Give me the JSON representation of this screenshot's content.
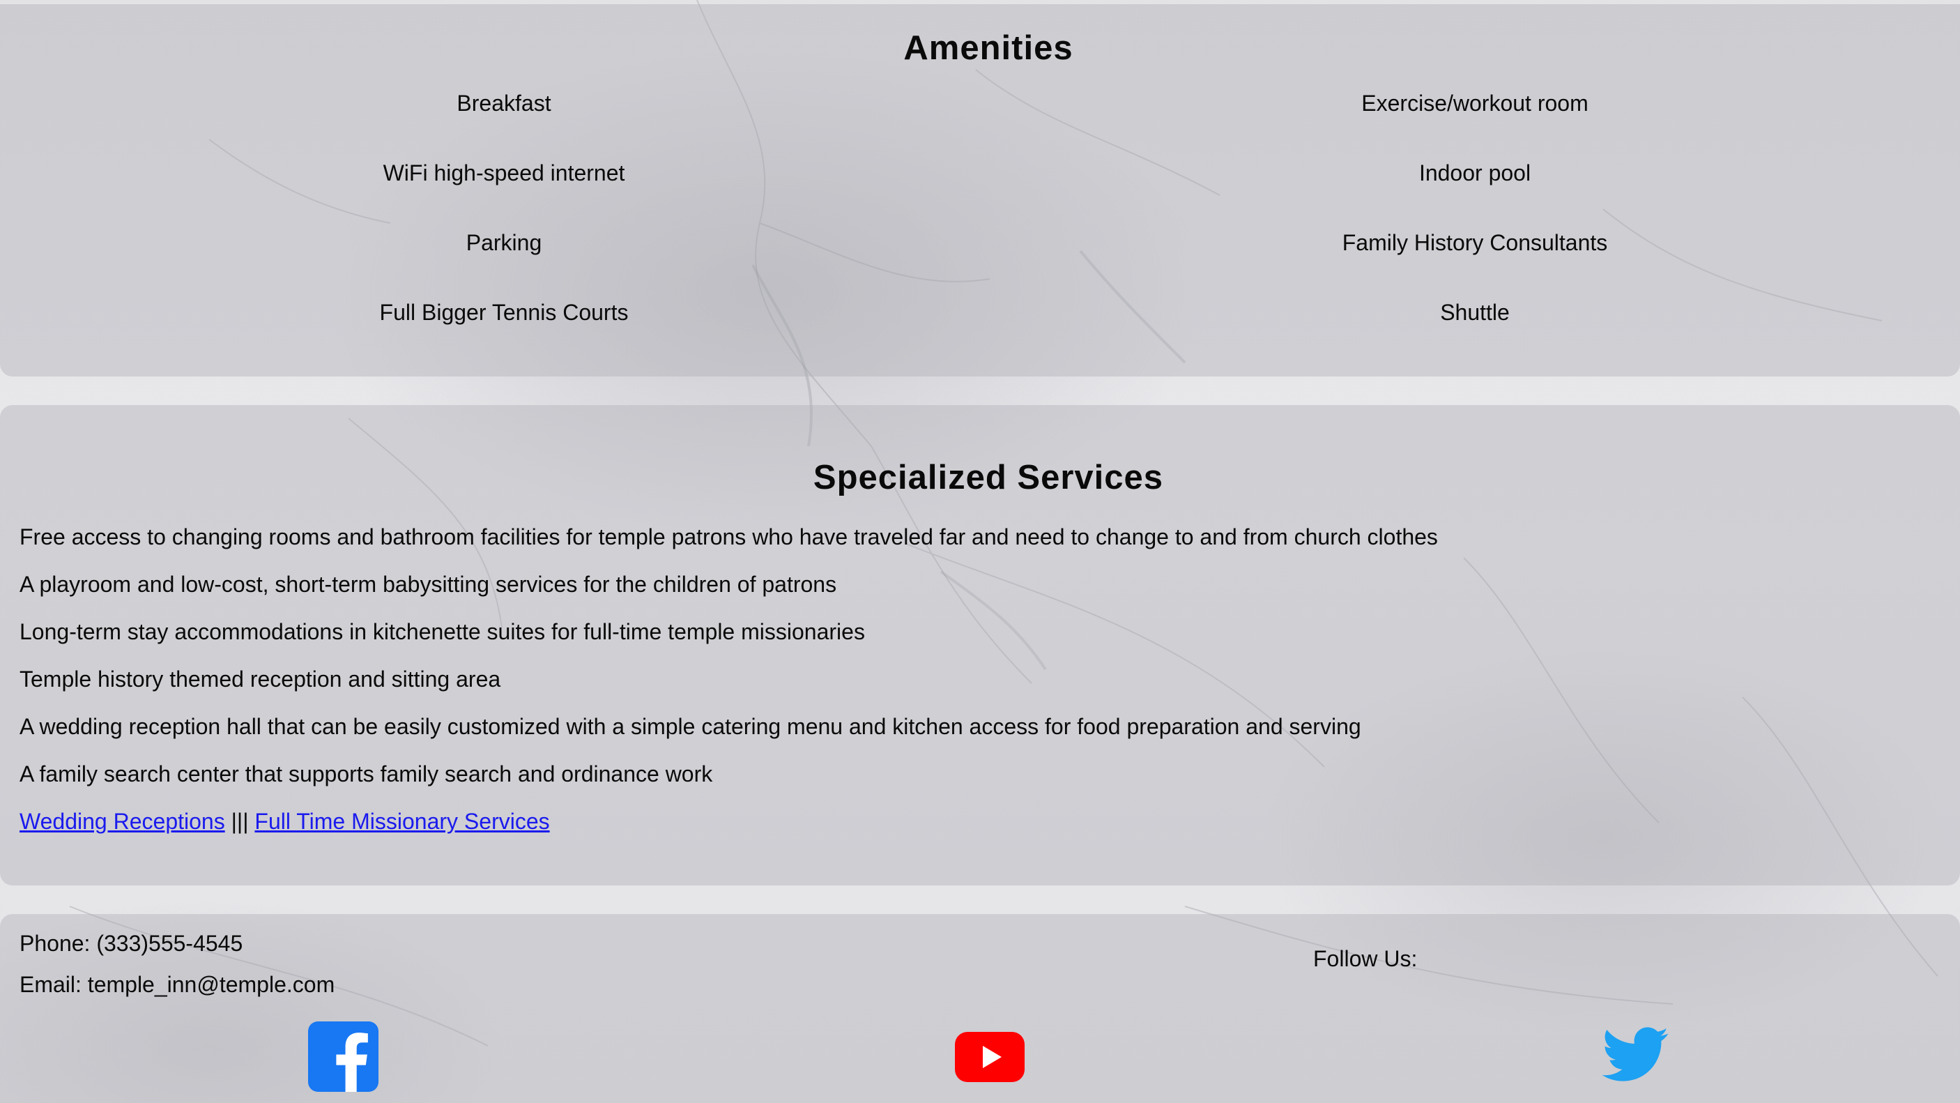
{
  "amenities": {
    "title": "Amenities",
    "left": [
      "Breakfast",
      "WiFi high-speed internet",
      "Parking",
      "Full Bigger Tennis Courts"
    ],
    "right": [
      "Exercise/workout room",
      "Indoor pool",
      "Family History Consultants",
      "Shuttle"
    ]
  },
  "services": {
    "title": "Specialized Services",
    "items": [
      "Free access to changing rooms and bathroom facilities for temple patrons who have traveled far and need to change to and from church clothes",
      "A playroom and low-cost, short-term babysitting services for the children of patrons",
      "Long-term stay accommodations in kitchenette suites for full-time temple missionaries",
      "Temple history themed reception and sitting area",
      "A wedding reception hall that can be easily customized with a simple catering menu and kitchen access for food preparation and serving",
      "A family search center that supports family search and ordinance work"
    ],
    "link_wedding": "Wedding Receptions",
    "link_separator": " ||| ",
    "link_missionary": "Full Time Missionary Services"
  },
  "footer": {
    "phone": "Phone: (333)555-4545",
    "email": "Email: temple_inn@temple.com",
    "follow": "Follow Us:",
    "social_icons": [
      "facebook-icon",
      "youtube-icon",
      "twitter-icon"
    ]
  },
  "colors": {
    "link": "#1a1aee",
    "facebook": "#1877f2",
    "youtube": "#ff0000",
    "twitter": "#1da1f2"
  }
}
